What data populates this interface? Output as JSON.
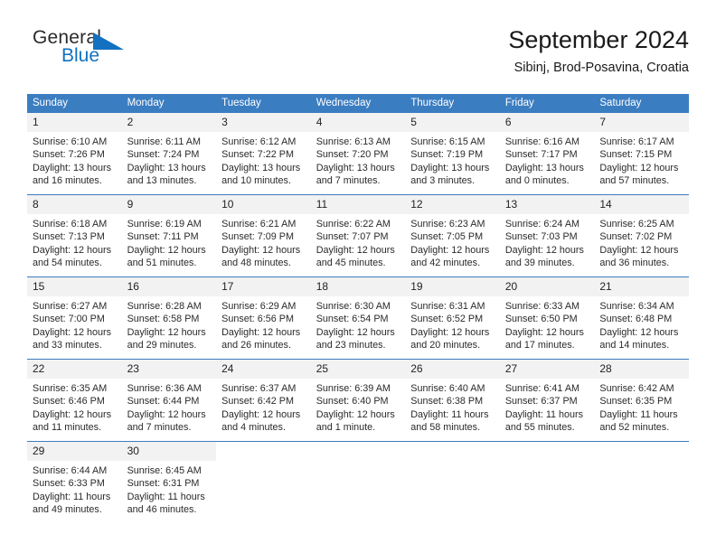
{
  "brand": {
    "name_part1": "General",
    "name_part2": "Blue",
    "logo_icon": "general-blue-triangle-logo",
    "accent_color": "#1271c0"
  },
  "header": {
    "title": "September 2024",
    "subtitle": "Sibinj, Brod-Posavina, Croatia"
  },
  "theme": {
    "header_bg": "#3b7dc1",
    "header_text": "#ffffff",
    "daynum_bg": "#f2f2f2",
    "body_text": "#2a2a2a"
  },
  "calendar": {
    "weekday_headers": [
      "Sunday",
      "Monday",
      "Tuesday",
      "Wednesday",
      "Thursday",
      "Friday",
      "Saturday"
    ],
    "weeks": [
      [
        {
          "day": "1",
          "sunrise": "Sunrise: 6:10 AM",
          "sunset": "Sunset: 7:26 PM",
          "daylight1": "Daylight: 13 hours",
          "daylight2": "and 16 minutes."
        },
        {
          "day": "2",
          "sunrise": "Sunrise: 6:11 AM",
          "sunset": "Sunset: 7:24 PM",
          "daylight1": "Daylight: 13 hours",
          "daylight2": "and 13 minutes."
        },
        {
          "day": "3",
          "sunrise": "Sunrise: 6:12 AM",
          "sunset": "Sunset: 7:22 PM",
          "daylight1": "Daylight: 13 hours",
          "daylight2": "and 10 minutes."
        },
        {
          "day": "4",
          "sunrise": "Sunrise: 6:13 AM",
          "sunset": "Sunset: 7:20 PM",
          "daylight1": "Daylight: 13 hours",
          "daylight2": "and 7 minutes."
        },
        {
          "day": "5",
          "sunrise": "Sunrise: 6:15 AM",
          "sunset": "Sunset: 7:19 PM",
          "daylight1": "Daylight: 13 hours",
          "daylight2": "and 3 minutes."
        },
        {
          "day": "6",
          "sunrise": "Sunrise: 6:16 AM",
          "sunset": "Sunset: 7:17 PM",
          "daylight1": "Daylight: 13 hours",
          "daylight2": "and 0 minutes."
        },
        {
          "day": "7",
          "sunrise": "Sunrise: 6:17 AM",
          "sunset": "Sunset: 7:15 PM",
          "daylight1": "Daylight: 12 hours",
          "daylight2": "and 57 minutes."
        }
      ],
      [
        {
          "day": "8",
          "sunrise": "Sunrise: 6:18 AM",
          "sunset": "Sunset: 7:13 PM",
          "daylight1": "Daylight: 12 hours",
          "daylight2": "and 54 minutes."
        },
        {
          "day": "9",
          "sunrise": "Sunrise: 6:19 AM",
          "sunset": "Sunset: 7:11 PM",
          "daylight1": "Daylight: 12 hours",
          "daylight2": "and 51 minutes."
        },
        {
          "day": "10",
          "sunrise": "Sunrise: 6:21 AM",
          "sunset": "Sunset: 7:09 PM",
          "daylight1": "Daylight: 12 hours",
          "daylight2": "and 48 minutes."
        },
        {
          "day": "11",
          "sunrise": "Sunrise: 6:22 AM",
          "sunset": "Sunset: 7:07 PM",
          "daylight1": "Daylight: 12 hours",
          "daylight2": "and 45 minutes."
        },
        {
          "day": "12",
          "sunrise": "Sunrise: 6:23 AM",
          "sunset": "Sunset: 7:05 PM",
          "daylight1": "Daylight: 12 hours",
          "daylight2": "and 42 minutes."
        },
        {
          "day": "13",
          "sunrise": "Sunrise: 6:24 AM",
          "sunset": "Sunset: 7:03 PM",
          "daylight1": "Daylight: 12 hours",
          "daylight2": "and 39 minutes."
        },
        {
          "day": "14",
          "sunrise": "Sunrise: 6:25 AM",
          "sunset": "Sunset: 7:02 PM",
          "daylight1": "Daylight: 12 hours",
          "daylight2": "and 36 minutes."
        }
      ],
      [
        {
          "day": "15",
          "sunrise": "Sunrise: 6:27 AM",
          "sunset": "Sunset: 7:00 PM",
          "daylight1": "Daylight: 12 hours",
          "daylight2": "and 33 minutes."
        },
        {
          "day": "16",
          "sunrise": "Sunrise: 6:28 AM",
          "sunset": "Sunset: 6:58 PM",
          "daylight1": "Daylight: 12 hours",
          "daylight2": "and 29 minutes."
        },
        {
          "day": "17",
          "sunrise": "Sunrise: 6:29 AM",
          "sunset": "Sunset: 6:56 PM",
          "daylight1": "Daylight: 12 hours",
          "daylight2": "and 26 minutes."
        },
        {
          "day": "18",
          "sunrise": "Sunrise: 6:30 AM",
          "sunset": "Sunset: 6:54 PM",
          "daylight1": "Daylight: 12 hours",
          "daylight2": "and 23 minutes."
        },
        {
          "day": "19",
          "sunrise": "Sunrise: 6:31 AM",
          "sunset": "Sunset: 6:52 PM",
          "daylight1": "Daylight: 12 hours",
          "daylight2": "and 20 minutes."
        },
        {
          "day": "20",
          "sunrise": "Sunrise: 6:33 AM",
          "sunset": "Sunset: 6:50 PM",
          "daylight1": "Daylight: 12 hours",
          "daylight2": "and 17 minutes."
        },
        {
          "day": "21",
          "sunrise": "Sunrise: 6:34 AM",
          "sunset": "Sunset: 6:48 PM",
          "daylight1": "Daylight: 12 hours",
          "daylight2": "and 14 minutes."
        }
      ],
      [
        {
          "day": "22",
          "sunrise": "Sunrise: 6:35 AM",
          "sunset": "Sunset: 6:46 PM",
          "daylight1": "Daylight: 12 hours",
          "daylight2": "and 11 minutes."
        },
        {
          "day": "23",
          "sunrise": "Sunrise: 6:36 AM",
          "sunset": "Sunset: 6:44 PM",
          "daylight1": "Daylight: 12 hours",
          "daylight2": "and 7 minutes."
        },
        {
          "day": "24",
          "sunrise": "Sunrise: 6:37 AM",
          "sunset": "Sunset: 6:42 PM",
          "daylight1": "Daylight: 12 hours",
          "daylight2": "and 4 minutes."
        },
        {
          "day": "25",
          "sunrise": "Sunrise: 6:39 AM",
          "sunset": "Sunset: 6:40 PM",
          "daylight1": "Daylight: 12 hours",
          "daylight2": "and 1 minute."
        },
        {
          "day": "26",
          "sunrise": "Sunrise: 6:40 AM",
          "sunset": "Sunset: 6:38 PM",
          "daylight1": "Daylight: 11 hours",
          "daylight2": "and 58 minutes."
        },
        {
          "day": "27",
          "sunrise": "Sunrise: 6:41 AM",
          "sunset": "Sunset: 6:37 PM",
          "daylight1": "Daylight: 11 hours",
          "daylight2": "and 55 minutes."
        },
        {
          "day": "28",
          "sunrise": "Sunrise: 6:42 AM",
          "sunset": "Sunset: 6:35 PM",
          "daylight1": "Daylight: 11 hours",
          "daylight2": "and 52 minutes."
        }
      ],
      [
        {
          "day": "29",
          "sunrise": "Sunrise: 6:44 AM",
          "sunset": "Sunset: 6:33 PM",
          "daylight1": "Daylight: 11 hours",
          "daylight2": "and 49 minutes."
        },
        {
          "day": "30",
          "sunrise": "Sunrise: 6:45 AM",
          "sunset": "Sunset: 6:31 PM",
          "daylight1": "Daylight: 11 hours",
          "daylight2": "and 46 minutes."
        },
        {
          "day": "",
          "sunrise": "",
          "sunset": "",
          "daylight1": "",
          "daylight2": ""
        },
        {
          "day": "",
          "sunrise": "",
          "sunset": "",
          "daylight1": "",
          "daylight2": ""
        },
        {
          "day": "",
          "sunrise": "",
          "sunset": "",
          "daylight1": "",
          "daylight2": ""
        },
        {
          "day": "",
          "sunrise": "",
          "sunset": "",
          "daylight1": "",
          "daylight2": ""
        },
        {
          "day": "",
          "sunrise": "",
          "sunset": "",
          "daylight1": "",
          "daylight2": ""
        }
      ]
    ]
  }
}
